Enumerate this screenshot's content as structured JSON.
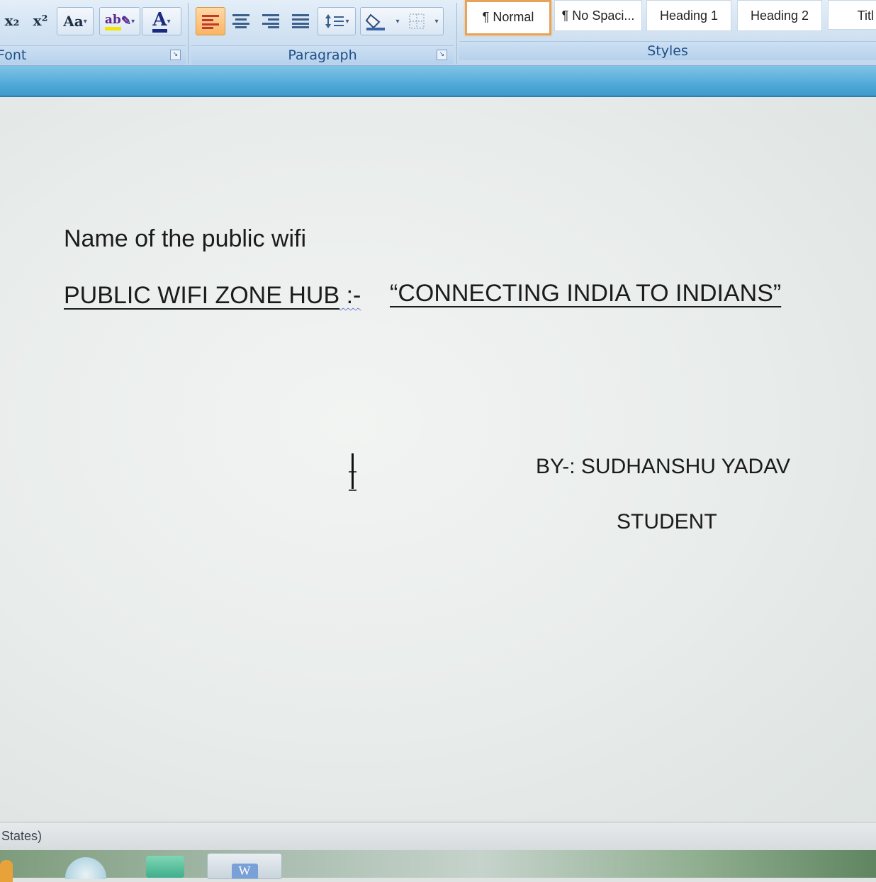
{
  "ribbon": {
    "font_group": {
      "label": "Font",
      "subscript_label": "x₂",
      "superscript_label": "x²",
      "change_case_label": "Aa",
      "highlight_label": "ab",
      "font_color_label": "A"
    },
    "paragraph_group": {
      "label": "Paragraph"
    },
    "styles_group": {
      "label": "Styles",
      "styles": [
        {
          "label": "¶ Normal",
          "selected": true
        },
        {
          "label": "¶ No Spaci...",
          "selected": false
        },
        {
          "label": "Heading 1",
          "selected": false
        },
        {
          "label": "Heading 2",
          "selected": false
        },
        {
          "label": "Titl",
          "selected": false
        }
      ]
    },
    "launcher_glyph": "↘"
  },
  "document": {
    "line1": "Name of the public wifi",
    "line2_title": "PUBLIC WIFI ZONE HUB",
    "line2_sep": " :-",
    "line2_slogan": "“CONNECTING INDIA TO INDIANS”",
    "author": "BY-: SUDHANSHU YADAV",
    "role": "STUDENT"
  },
  "status_bar": {
    "text": "States)"
  },
  "taskbar": {
    "word_icon_label": "W"
  },
  "colors": {
    "ribbon_label": "#1f4f86",
    "band": "#4ba6d6",
    "selected_style_border": "#e8a35a",
    "active_align": "#f9b564"
  }
}
